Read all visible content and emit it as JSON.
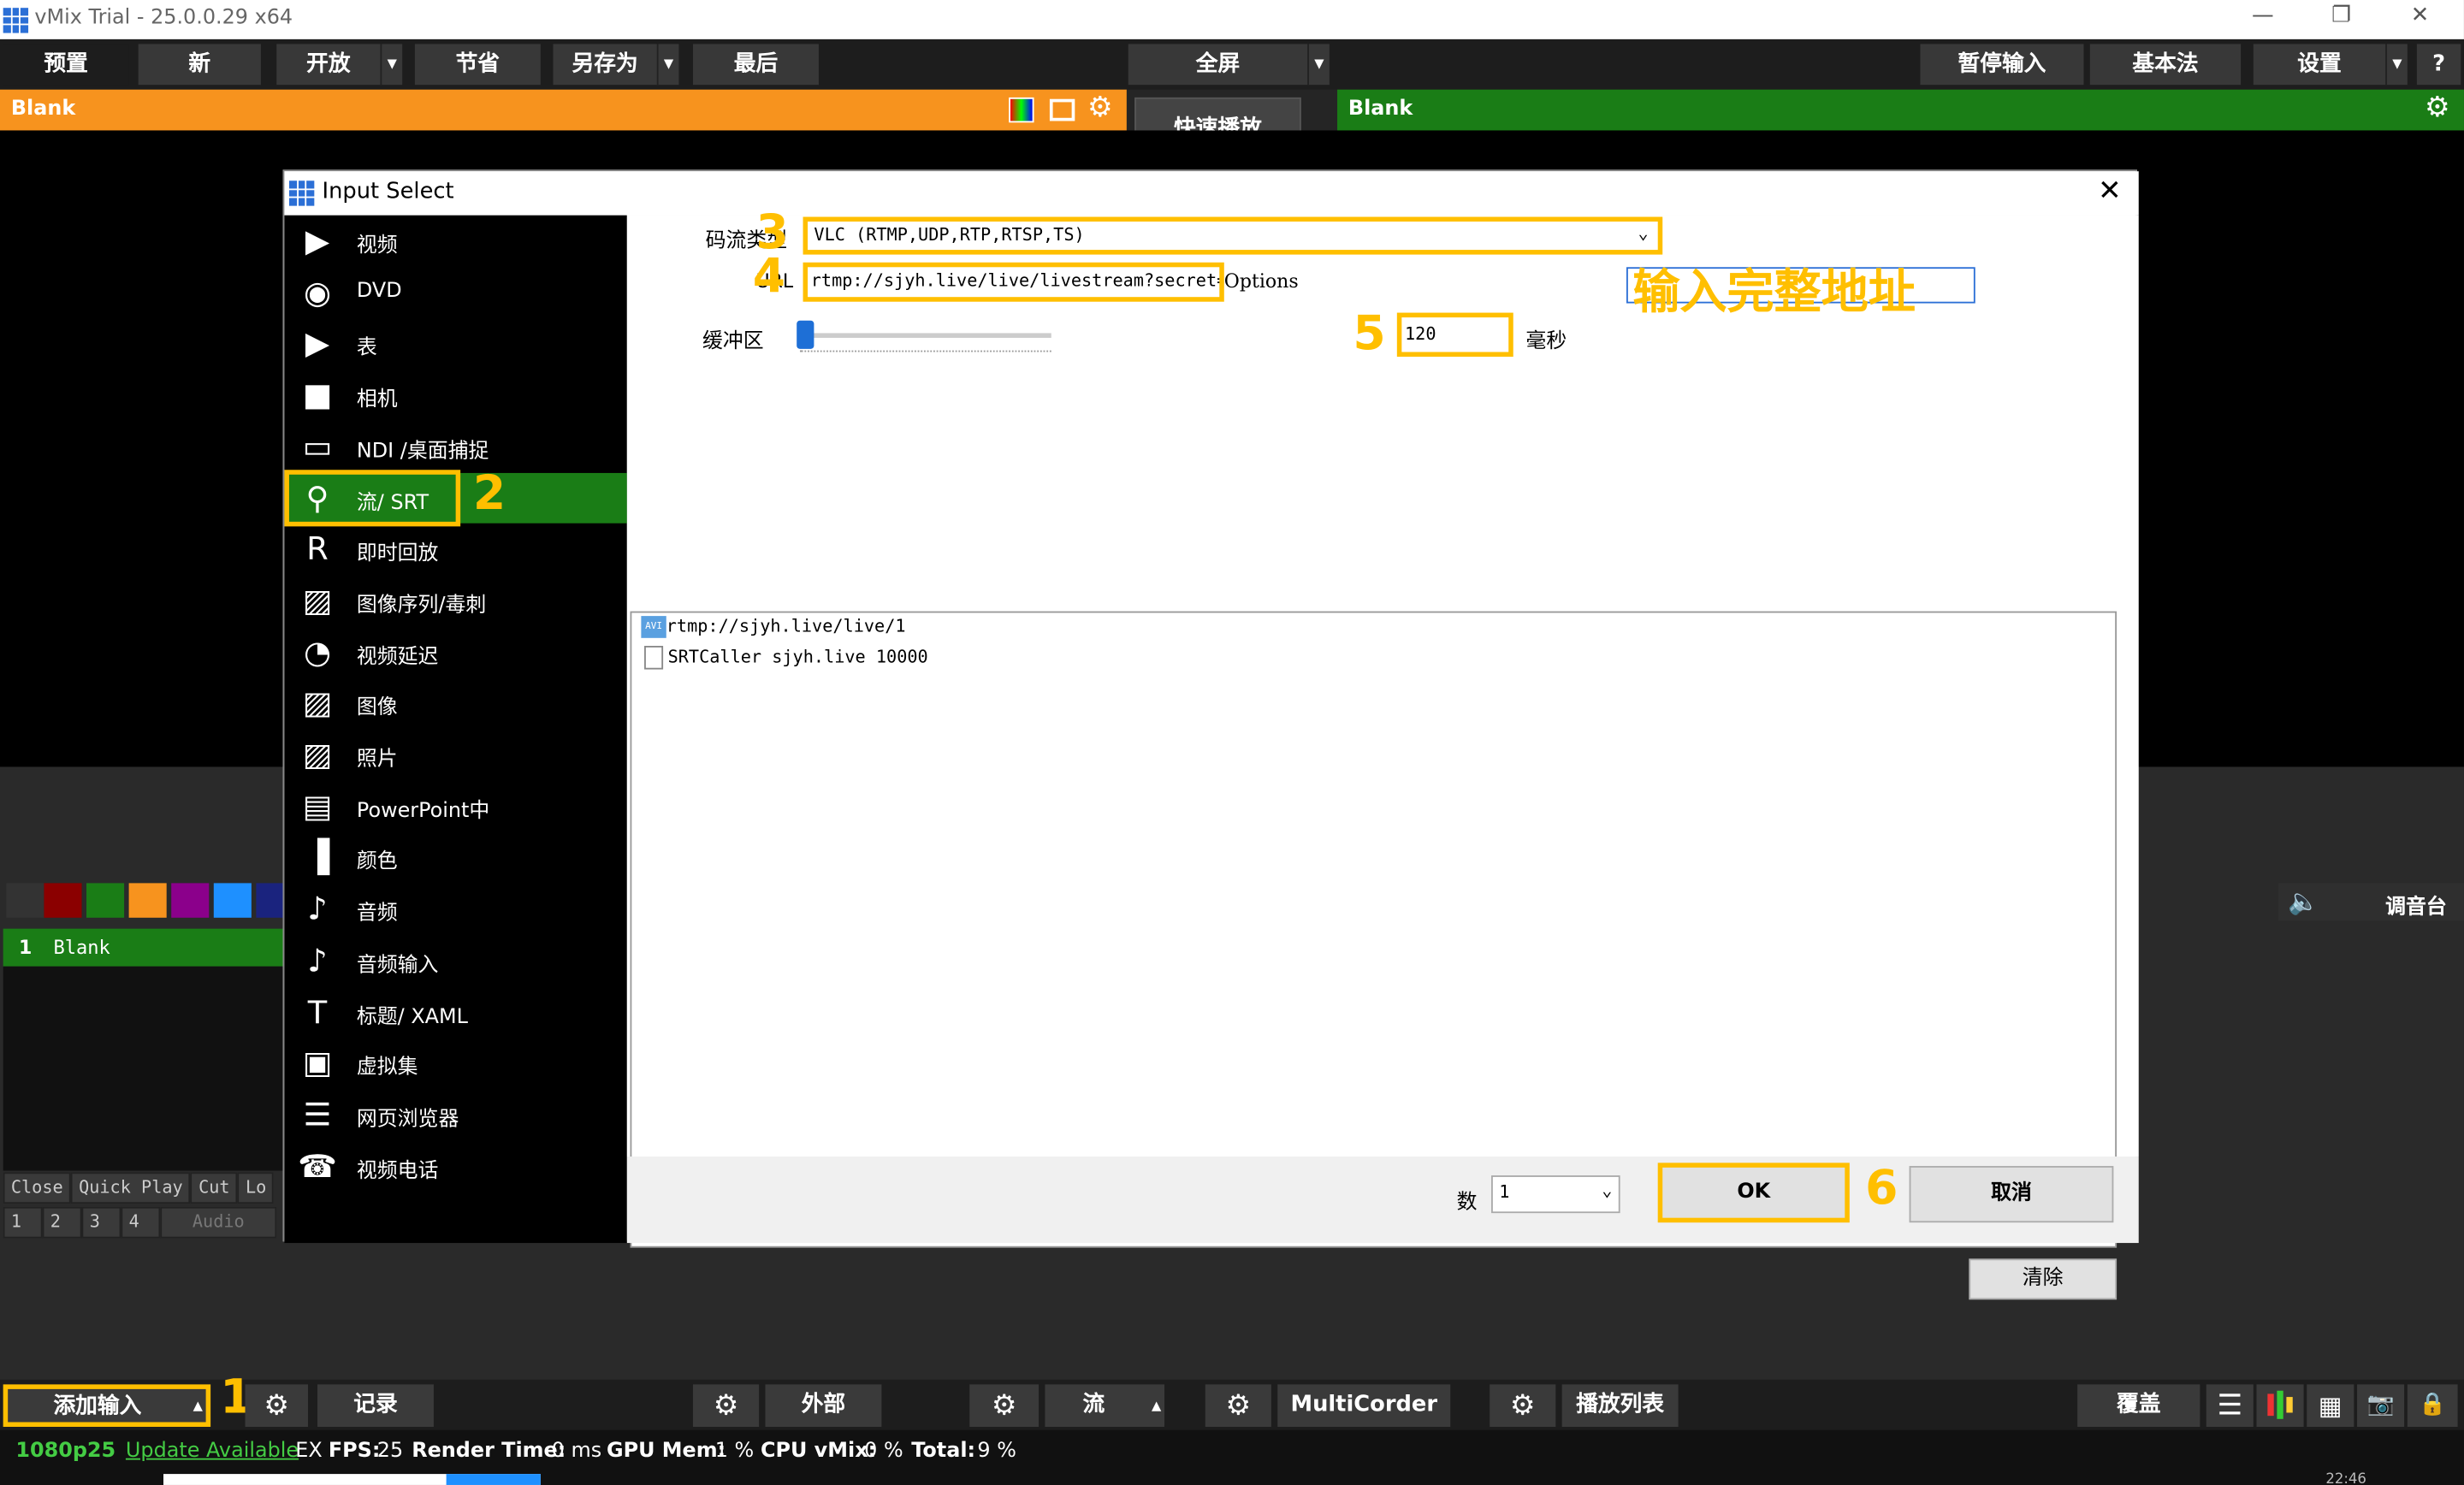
{
  "app": {
    "title": "vMix Trial - 25.0.0.29 x64"
  },
  "toolbar": {
    "preview": "预置",
    "new": "新",
    "open": "开放",
    "save": "节省",
    "save_as": "另存为",
    "last": "最后",
    "fullscreen": "全屏",
    "pause_input": "暂停输入",
    "basic": "基本法",
    "settings": "设置",
    "help": "?"
  },
  "preview": {
    "label": "Blank"
  },
  "program": {
    "label": "Blank"
  },
  "quickplay": "快速播放",
  "colors": [
    "#333333",
    "#8b0000",
    "#1a7d16",
    "#f7931e",
    "#8b008b",
    "#1e90ff",
    "#1a237e"
  ],
  "inputs": [
    {
      "num": "1",
      "name": "Blank"
    }
  ],
  "input_cells": {
    "row1": [
      "Close",
      "Quick Play",
      "Cut",
      "Lo"
    ],
    "row2": [
      "1",
      "2",
      "3",
      "4",
      "Audio"
    ]
  },
  "audio": {
    "mixer": "调音台"
  },
  "dialog": {
    "title": "Input Select",
    "categories": [
      {
        "label": "视频",
        "icon": "▶"
      },
      {
        "label": "DVD",
        "icon": "◉"
      },
      {
        "label": "表",
        "icon": "▶"
      },
      {
        "label": "相机",
        "icon": "■"
      },
      {
        "label": "NDI /桌面捕捉",
        "icon": "▭"
      },
      {
        "label": "流/ SRT",
        "icon": "⚲"
      },
      {
        "label": "即时回放",
        "icon": "R"
      },
      {
        "label": "图像序列/毒刺",
        "icon": "▨"
      },
      {
        "label": "视频延迟",
        "icon": "◔"
      },
      {
        "label": "图像",
        "icon": "▨"
      },
      {
        "label": "照片",
        "icon": "▨"
      },
      {
        "label": "PowerPoint中",
        "icon": "▤"
      },
      {
        "label": "颜色",
        "icon": "▐"
      },
      {
        "label": "音频",
        "icon": "♪"
      },
      {
        "label": "音频输入",
        "icon": "♪"
      },
      {
        "label": "标题/ XAML",
        "icon": "T"
      },
      {
        "label": "虚拟集",
        "icon": "▣"
      },
      {
        "label": "网页浏览器",
        "icon": "☰"
      },
      {
        "label": "视频电话",
        "icon": "☎"
      }
    ],
    "stream_type_label": "码流类型",
    "stream_type_value": "VLC (RTMP,UDP,RTP,RTSP,TS)",
    "url_label": "URL",
    "url_value": "rtmp://sjyh.live/live/livestream?secret=",
    "options_label": "Options",
    "buffer_label": "缓冲区",
    "buffer_value": "120",
    "buffer_unit": "毫秒",
    "history": [
      {
        "text": "rtmp://sjyh.live/live/1",
        "icon": "avi-icon"
      },
      {
        "text": "SRTCaller sjyh.live 10000",
        "icon": "file-icon"
      }
    ],
    "clear": "清除",
    "count_label": "数",
    "count_value": "1",
    "ok": "OK",
    "cancel": "取消"
  },
  "annotations": {
    "n1": "1",
    "n2": "2",
    "n3": "3",
    "n4": "4",
    "n5": "5",
    "n6": "6",
    "url_hint": "输入完整地址"
  },
  "bottom": {
    "add_input": "添加输入",
    "record": "记录",
    "external": "外部",
    "stream": "流",
    "multicorder": "MultiCorder",
    "playlist": "播放列表",
    "overlay": "覆盖"
  },
  "status": {
    "res": "1080p25",
    "update": "Update Available",
    "ex": "EX",
    "fps_label": "FPS:",
    "fps": "25",
    "rt_label": "Render Time:",
    "rt": "0 ms",
    "gpu_label": "GPU Mem:",
    "gpu": "1 %",
    "cpu_label": "CPU vMix:",
    "cpu": "0 %",
    "total_label": "Total:",
    "total": "9 %",
    "clock": "22:46"
  }
}
